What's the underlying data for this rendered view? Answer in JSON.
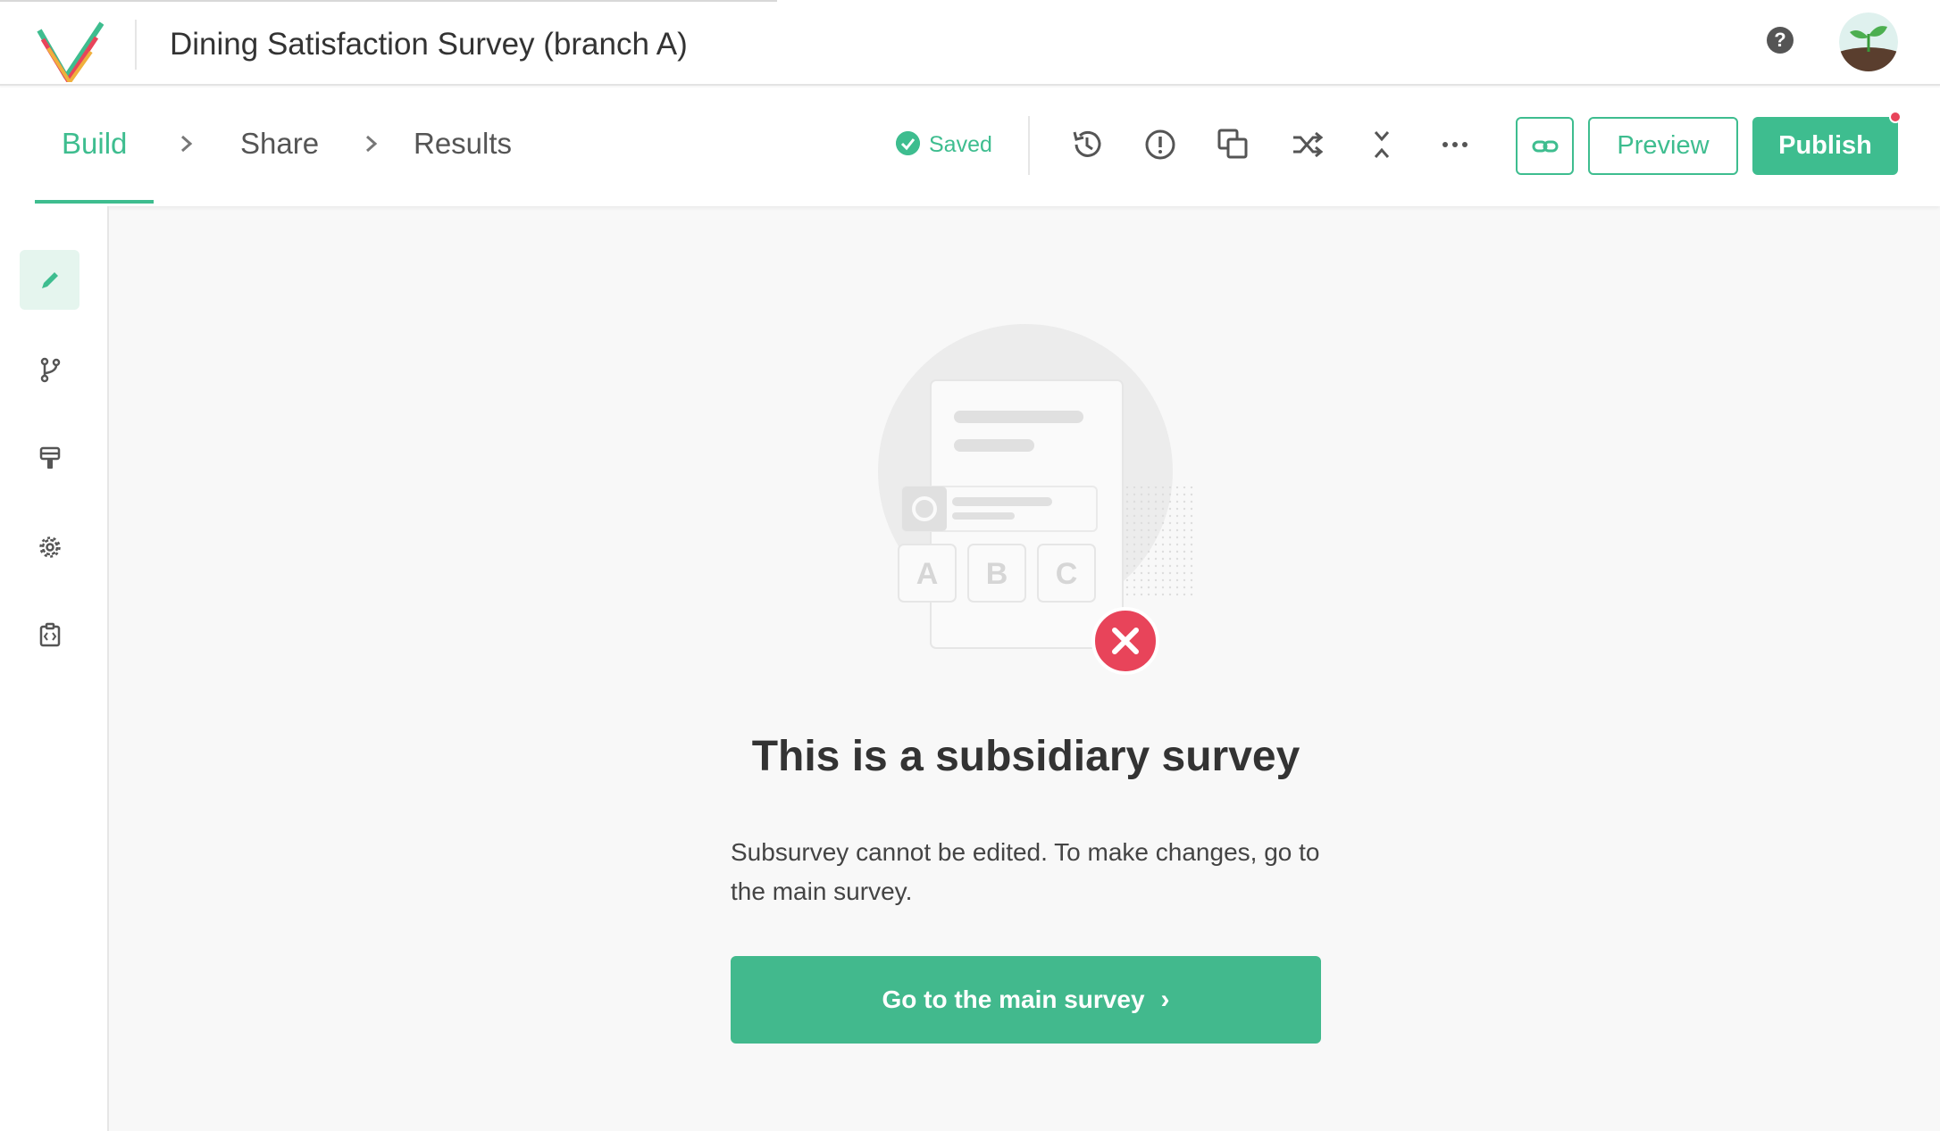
{
  "header": {
    "survey_title": "Dining Satisfaction Survey (branch A)",
    "help_icon_glyph": "?"
  },
  "nav": {
    "steps": [
      {
        "label": "Build",
        "active": true
      },
      {
        "label": "Share",
        "active": false
      },
      {
        "label": "Results",
        "active": false
      }
    ],
    "save_status": "Saved",
    "tools": [
      "history-icon",
      "alert-circle-icon",
      "copy-icon",
      "shuffle-icon",
      "collapse-icon",
      "more-icon"
    ],
    "link_button_icon": "link-icon",
    "preview_label": "Preview",
    "publish_label": "Publish"
  },
  "sidebar": {
    "items": [
      {
        "icon": "pencil-icon",
        "active": true
      },
      {
        "icon": "branch-icon",
        "active": false
      },
      {
        "icon": "paint-roller-icon",
        "active": false
      },
      {
        "icon": "gear-icon",
        "active": false
      },
      {
        "icon": "code-icon",
        "active": false
      }
    ]
  },
  "main": {
    "illustration": {
      "choices": [
        "A",
        "B",
        "C"
      ]
    },
    "heading": "This is a subsidiary survey",
    "description": "Subsurvey cannot be edited. To make changes, go to the main survey.",
    "button_label": "Go to the main survey",
    "button_arrow": "›"
  },
  "colors": {
    "accent": "#3ebd8f",
    "error": "#e8445a",
    "background": "#f8f8f8"
  }
}
